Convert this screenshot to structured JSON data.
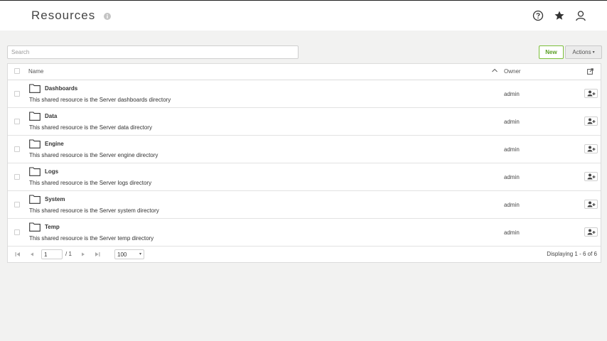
{
  "header": {
    "title": "Resources"
  },
  "search": {
    "placeholder": "Search",
    "value": ""
  },
  "toolbar": {
    "new_label": "New",
    "actions_label": "Actions"
  },
  "table": {
    "columns": {
      "name": "Name",
      "owner": "Owner"
    },
    "rows": [
      {
        "name": "Dashboards",
        "description": "This shared resource is the Server dashboards directory",
        "owner": "admin"
      },
      {
        "name": "Data",
        "description": "This shared resource is the Server data directory",
        "owner": "admin"
      },
      {
        "name": "Engine",
        "description": "This shared resource is the Server engine directory",
        "owner": "admin"
      },
      {
        "name": "Logs",
        "description": "This shared resource is the Server logs directory",
        "owner": "admin"
      },
      {
        "name": "System",
        "description": "This shared resource is the Server system directory",
        "owner": "admin"
      },
      {
        "name": "Temp",
        "description": "This shared resource is the Server temp directory",
        "owner": "admin"
      }
    ]
  },
  "pagination": {
    "current_page": "1",
    "total_pages": "/ 1",
    "per_page": "100",
    "displaying": "Displaying 1 - 6 of 6"
  },
  "icons": {
    "info": "info-icon",
    "help": "help-icon",
    "favorites": "star-icon",
    "user": "user-icon",
    "folder": "folder-icon",
    "share": "add-user-icon",
    "export": "export-icon",
    "sort": "chevron-up-icon"
  },
  "colors": {
    "accent": "#7cbf3a",
    "background": "#f2f2f1"
  }
}
